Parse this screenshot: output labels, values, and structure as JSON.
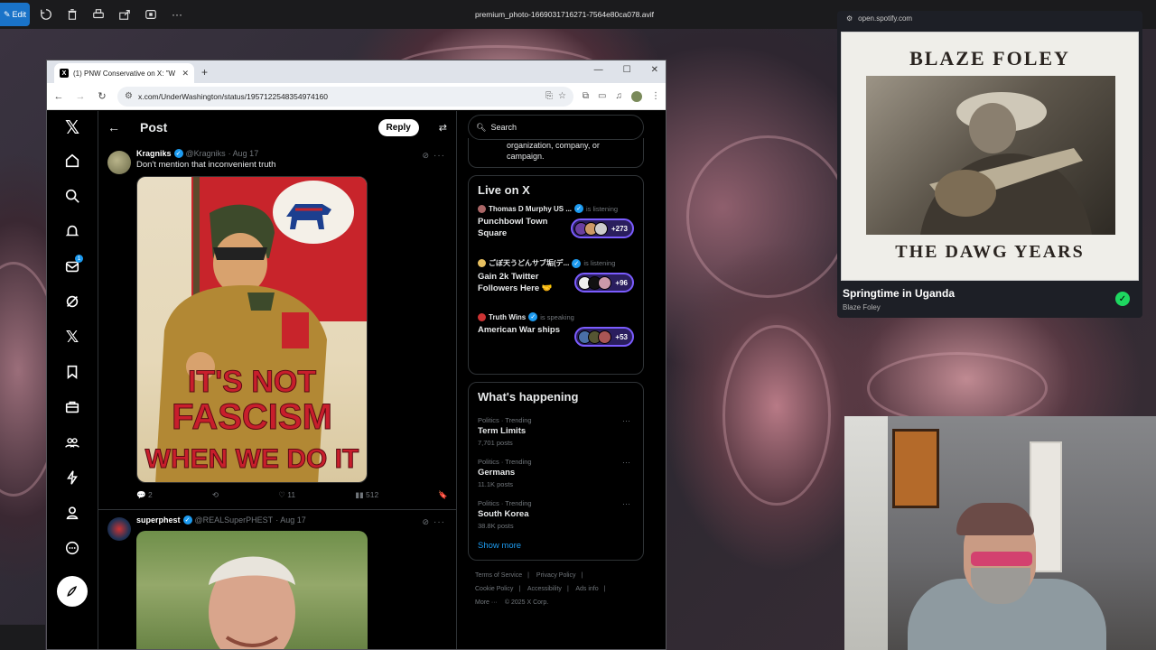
{
  "viewer": {
    "edit_label": "Edit",
    "file_title": "premium_photo-1669031716271-7564e80ca078.avif"
  },
  "browser": {
    "tab_title": "(1) PNW Conservative on X: \"W",
    "url": "x.com/UnderWashington/status/1957122548354974160"
  },
  "x": {
    "header_title": "Post",
    "reply_label": "Reply",
    "tweets": [
      {
        "name": "Kragniks",
        "handle": "@Kragniks",
        "date": "· Aug 17",
        "text": "Don't mention that inconvenient truth",
        "poster_lines": [
          "IT'S NOT",
          "FASCISM",
          "WHEN WE DO IT"
        ],
        "poster_badge": "DEM",
        "replies": "2",
        "reposts": "",
        "likes": "11",
        "views": "512"
      },
      {
        "name": "superphest",
        "handle": "@REALSuperPHEST",
        "date": "· Aug 17"
      }
    ],
    "search_placeholder": "Search",
    "partial_card_text": "organization, company, or campaign.",
    "live": {
      "title": "Live on X",
      "items": [
        {
          "host": "Thomas D Murphy US ...",
          "state": "is listening",
          "title": "Punchbowl Town Square",
          "count": "+273"
        },
        {
          "host": "ごぼ天うどんサブ垢(デ...",
          "state": "is listening",
          "title": "Gain 2k Twitter Followers Here 🤝",
          "count": "+96"
        },
        {
          "host": "Truth Wins",
          "state": "is speaking",
          "title": "American War ships",
          "count": "+53"
        }
      ]
    },
    "happening": {
      "title": "What's happening",
      "trends": [
        {
          "category": "Politics · Trending",
          "name": "Term Limits",
          "count": "7,701 posts"
        },
        {
          "category": "Politics · Trending",
          "name": "Germans",
          "count": "11.1K posts"
        },
        {
          "category": "Politics · Trending",
          "name": "South Korea",
          "count": "38.8K posts"
        }
      ],
      "show_more": "Show more"
    },
    "footer": {
      "links": [
        "Terms of Service",
        "|",
        "Privacy Policy",
        "|",
        "Cookie Policy",
        "|",
        "Accessibility",
        "|",
        "Ads info",
        "|",
        "More ···",
        "© 2025 X Corp."
      ]
    },
    "notif_badge": "1"
  },
  "spotify": {
    "url": "open.spotify.com",
    "album_top": "BLAZE FOLEY",
    "album_bottom": "THE DAWG YEARS",
    "track": "Springtime in Uganda",
    "artist": "Blaze Foley"
  }
}
